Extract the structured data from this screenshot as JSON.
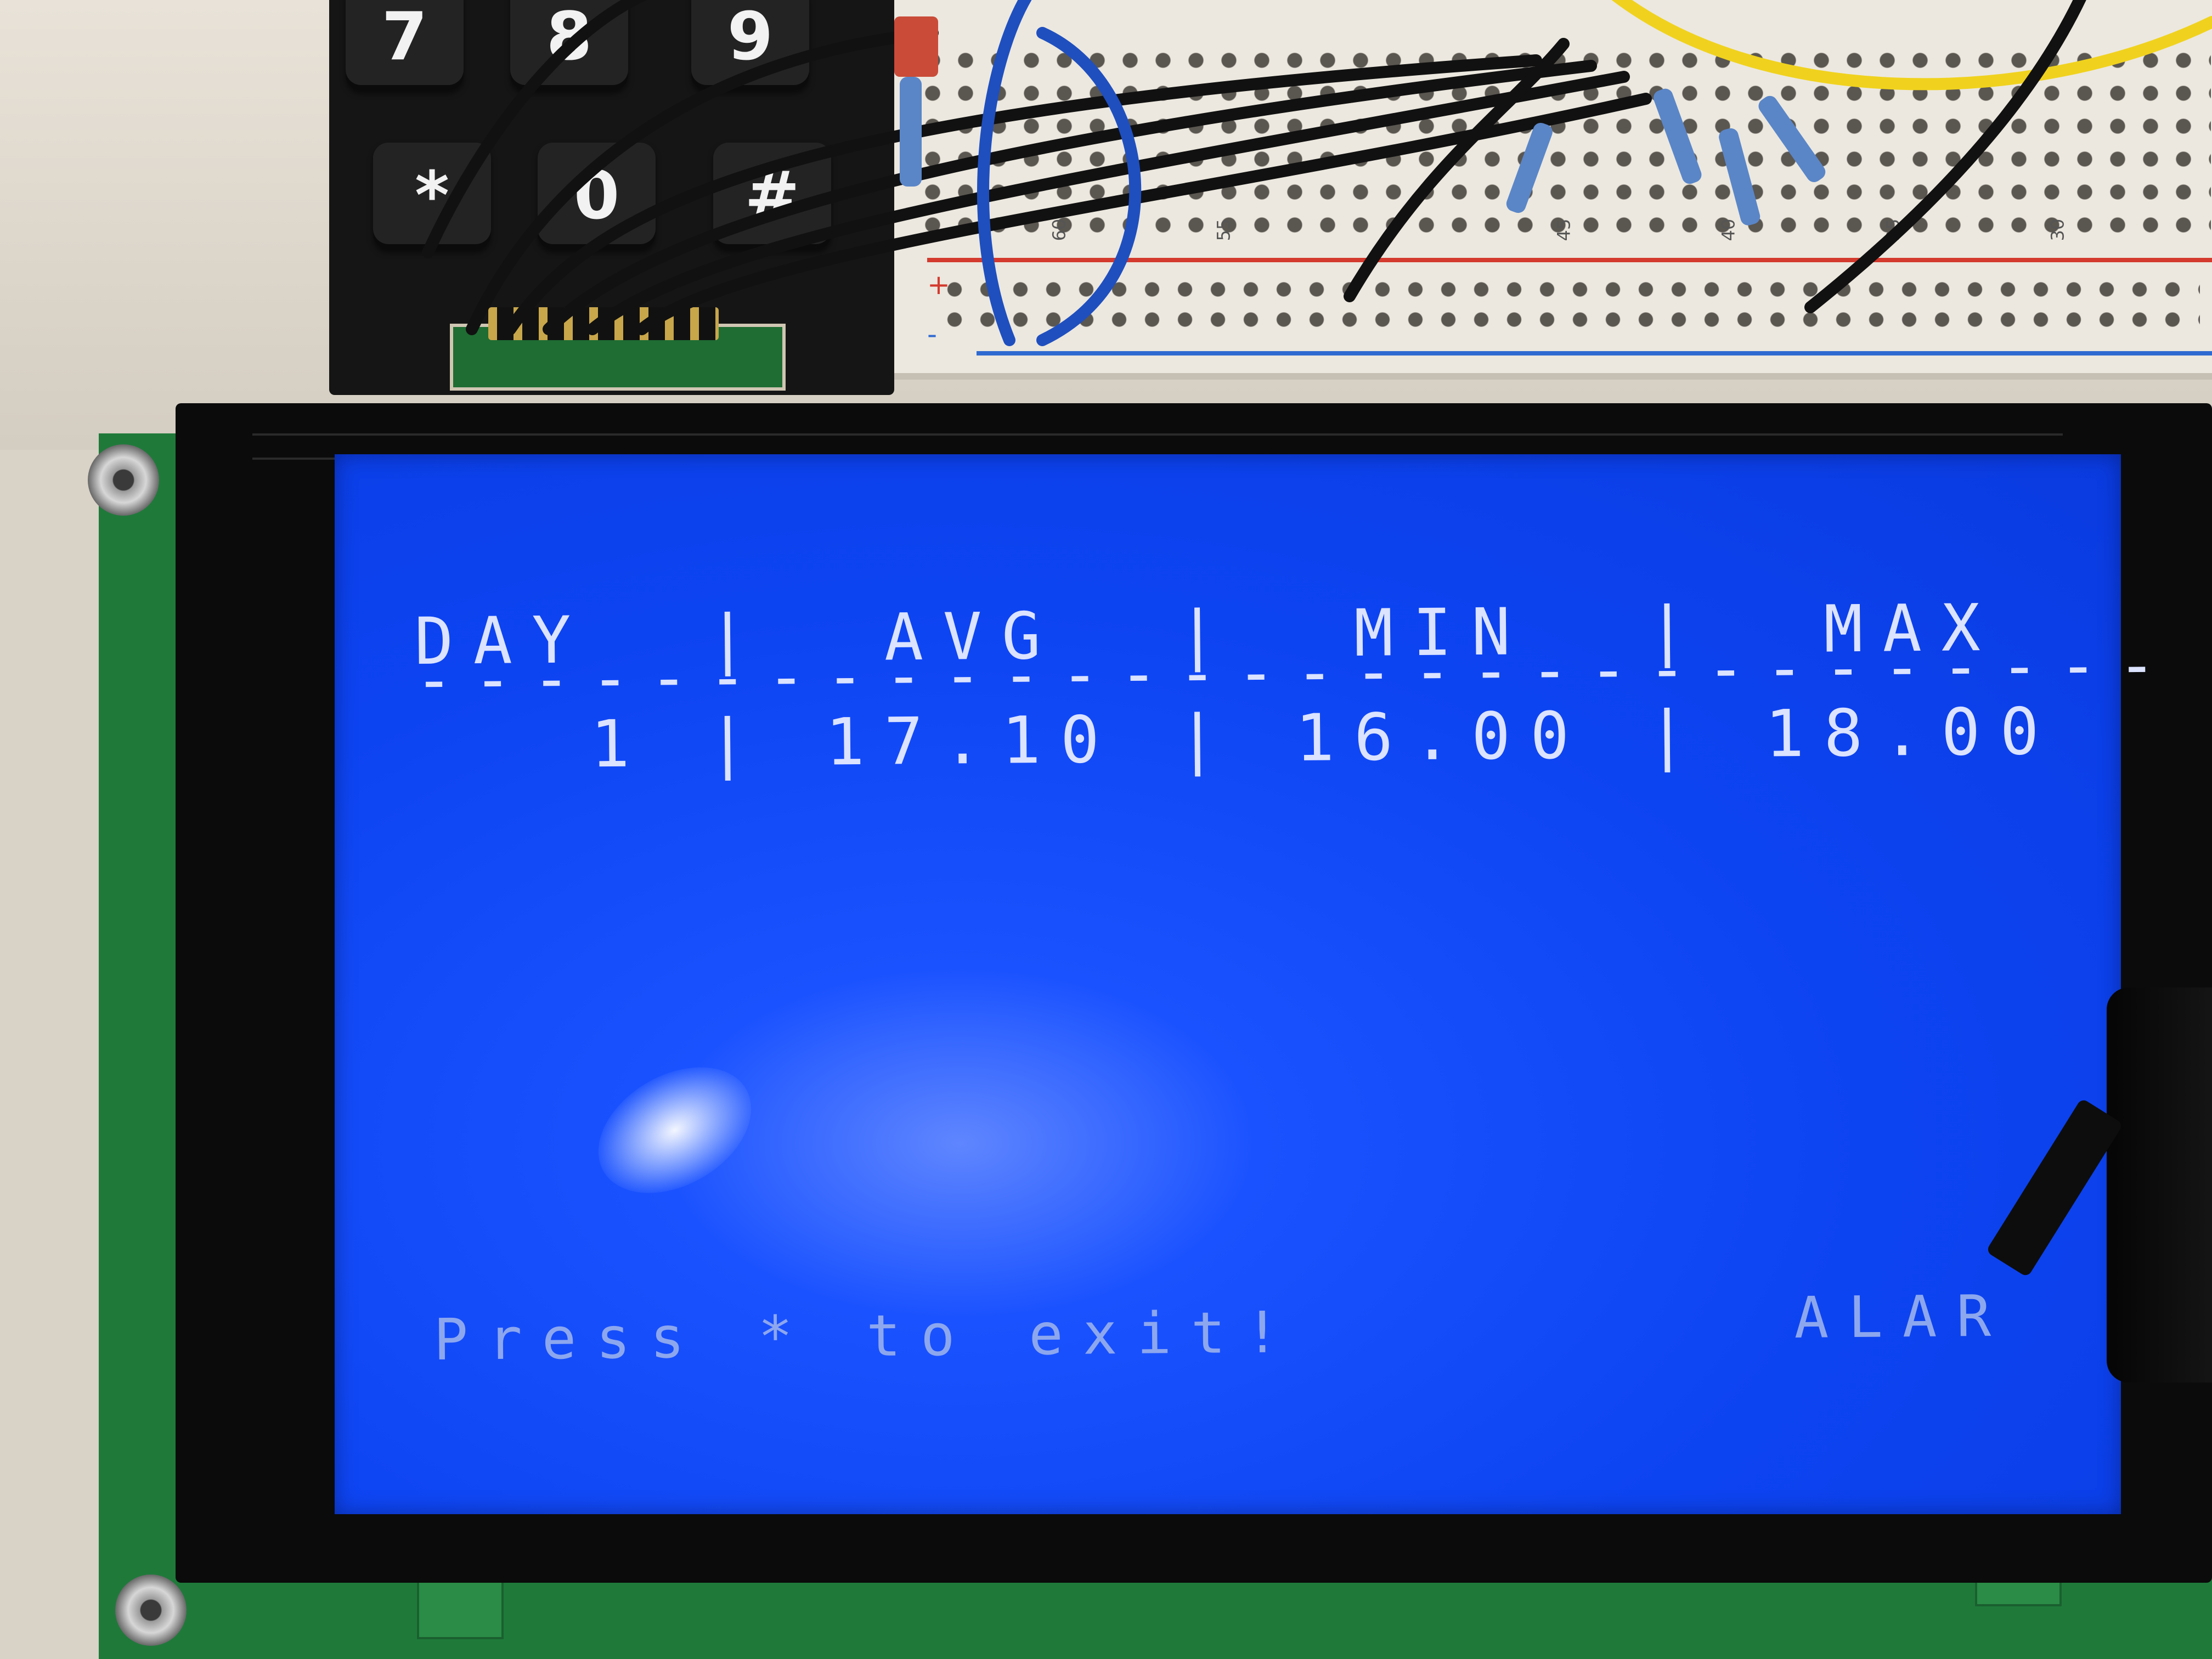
{
  "keypad": {
    "keys": [
      "7",
      "8",
      "9",
      "*",
      "0",
      "#"
    ]
  },
  "breadboard": {
    "column_numbers": [
      "60",
      "55",
      "45",
      "40",
      "35",
      "30"
    ],
    "rail_plus": "+",
    "rail_minus": "-"
  },
  "lcd": {
    "header": "DAY  |  AVG  |  MIN  |  MAX",
    "separator": "------------------------------",
    "rows": [
      {
        "day": "1",
        "avg": "17.10",
        "min": "16.00",
        "max": "18.00"
      }
    ],
    "row_text": "   1 | 17.10 | 16.00 | 18.00",
    "footer": "Press * to exit!",
    "alarm": "ALAR"
  },
  "colors": {
    "lcd_background": "#0d44f2",
    "lcd_text": "#dbe3ff",
    "pcb": "#1f7a3a",
    "bezel": "#0b0b0b"
  }
}
